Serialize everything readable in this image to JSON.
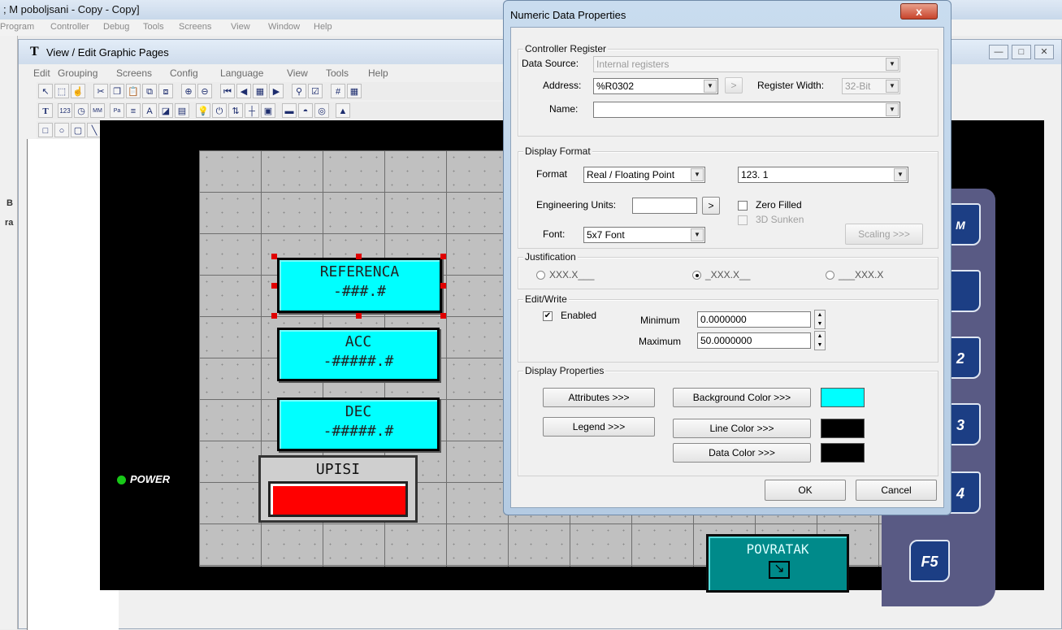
{
  "app": {
    "title": "; M poboljsani - Copy - Copy]",
    "menu": [
      "Program",
      "Controller",
      "Debug",
      "Tools",
      "Screens",
      "View",
      "Window",
      "Help"
    ]
  },
  "left_strip_labels": [
    "B",
    "ra"
  ],
  "inner_window": {
    "title": "View / Edit Graphic Pages",
    "menu": [
      "Edit",
      "Grouping",
      "Screens",
      "Config",
      "Language",
      "View",
      "Tools",
      "Help"
    ]
  },
  "panel": {
    "displays": [
      {
        "label": "REFERENCA",
        "format": "-###.#"
      },
      {
        "label": "ACC",
        "format": "-#####.#"
      },
      {
        "label": "DEC",
        "format": "-#####.#"
      }
    ],
    "upisi_label": "UPISI",
    "power_label": "POWER",
    "povratak_label": "POVRATAK",
    "fkeys": [
      "M",
      "",
      "2",
      "3",
      "4",
      "F5"
    ]
  },
  "dialog": {
    "title": "Numeric Data Properties",
    "close_label": "x",
    "controller_register": {
      "group_label": "Controller Register",
      "data_source_label": "Data Source:",
      "data_source_value": "Internal registers",
      "address_label": "Address:",
      "address_value": "%R0302",
      "arrow_btn": ">",
      "register_width_label": "Register Width:",
      "register_width_value": "32-Bit",
      "name_label": "Name:",
      "name_value": ""
    },
    "display_format": {
      "group_label": "Display Format",
      "format_label": "Format",
      "format_value": "Real / Floating Point",
      "pattern_value": "123. 1",
      "eng_units_label": "Engineering Units:",
      "eng_units_value": "",
      "eng_btn": ">",
      "zero_filled_label": "Zero Filled",
      "sunken_label": "3D Sunken",
      "font_label": "Font:",
      "font_value": "5x7 Font",
      "scaling_label": "Scaling >>>"
    },
    "justification": {
      "group_label": "Justification",
      "options": [
        "XXX.X___",
        "_XXX.X__",
        "___XXX.X"
      ],
      "selected_index": 1
    },
    "edit_write": {
      "group_label": "Edit/Write",
      "enabled_label": "Enabled",
      "enabled": true,
      "minimum_label": "Minimum",
      "minimum_value": "0.0000000",
      "maximum_label": "Maximum",
      "maximum_value": "50.0000000"
    },
    "display_properties": {
      "group_label": "Display Properties",
      "attributes_label": "Attributes >>>",
      "legend_label": "Legend >>>",
      "background_color_label": "Background Color >>>",
      "line_color_label": "Line Color >>>",
      "data_color_label": "Data Color >>>",
      "background_color": "#00ffff",
      "line_color": "#000000",
      "data_color": "#000000"
    },
    "ok_label": "OK",
    "cancel_label": "Cancel"
  }
}
